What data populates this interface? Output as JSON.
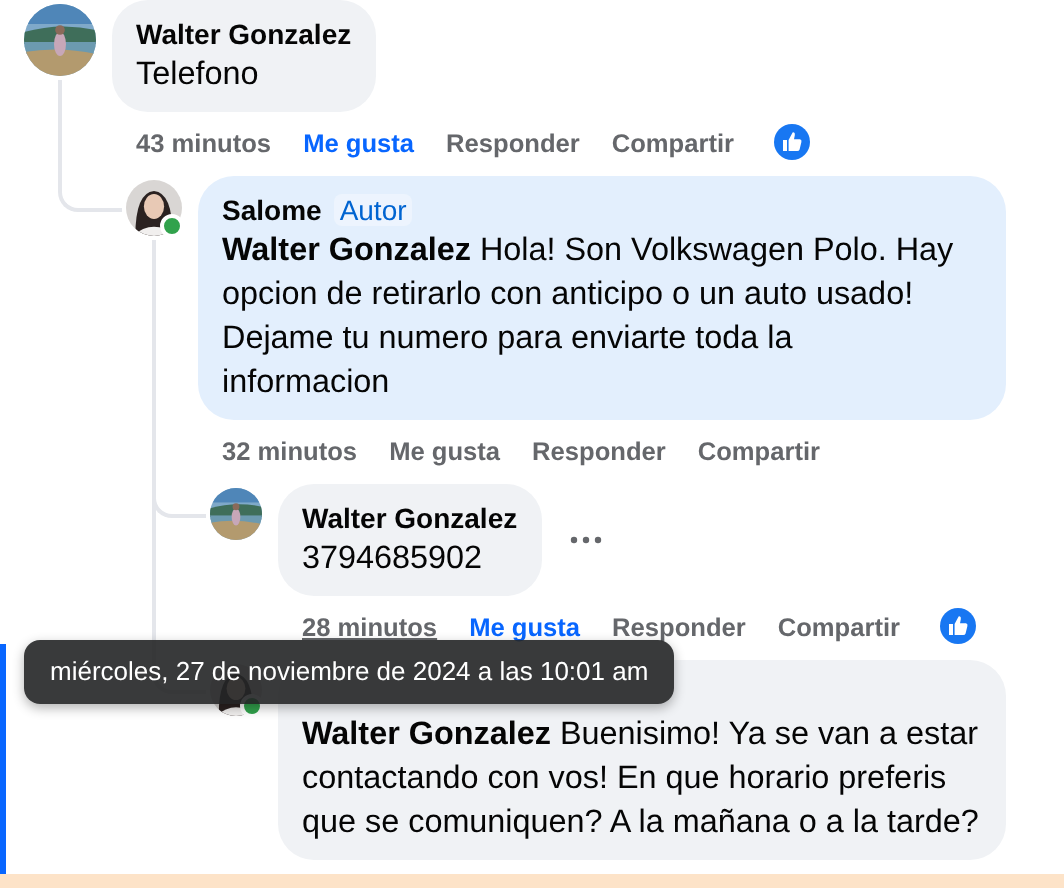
{
  "comments": [
    {
      "author": "Walter Gonzalez",
      "text": "Telefono",
      "time": "43 minutos",
      "like_label": "Me gusta",
      "liked": true,
      "reply_label": "Responder",
      "share_label": "Compartir",
      "reaction_shown": true,
      "replies": [
        {
          "author": "Salome",
          "badge": "Autor",
          "online": true,
          "highlighted": true,
          "mention": "Walter Gonzalez",
          "text": "Hola! Son Volkswagen Polo. Hay opcion de retirarlo con anticipo o un auto usado! Dejame tu numero para enviarte toda la informacion",
          "time": "32 minutos",
          "like_label": "Me gusta",
          "liked": false,
          "reply_label": "Responder",
          "share_label": "Compartir",
          "reaction_shown": false,
          "replies": [
            {
              "author": "Walter Gonzalez",
              "text": "3794685902",
              "more_button": true,
              "time": "28 minutos",
              "time_hovered": true,
              "like_label": "Me gusta",
              "liked": true,
              "reply_label": "Responder",
              "share_label": "Compartir",
              "reaction_shown": true
            },
            {
              "online": true,
              "highlighted": false,
              "mention": "Walter Gonzalez",
              "text": "Buenisimo! Ya se van a estar contactando con vos! En que horario preferis que se comuniquen? A la mañana o a la tarde?"
            }
          ]
        }
      ]
    }
  ],
  "tooltip": {
    "text": "miércoles, 27 de noviembre de 2024 a las 10:01 am"
  }
}
